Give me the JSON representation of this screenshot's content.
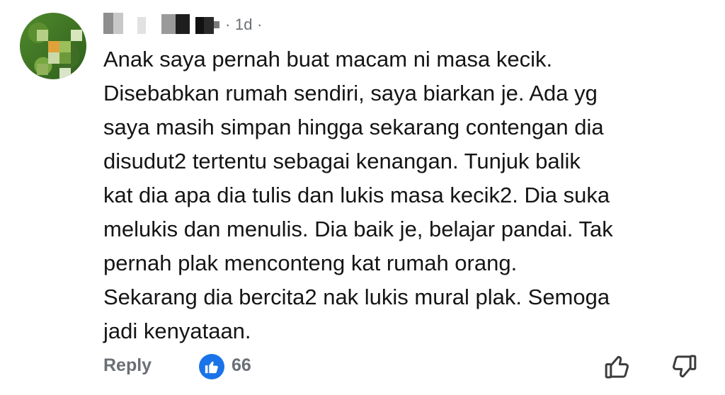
{
  "comment": {
    "author_blurred": true,
    "meta": "· 1d ·",
    "text": "Anak saya pernah buat macam ni masa kecik.\nDisebabkan rumah sendiri, saya biarkan je. Ada yg\nsaya masih simpan hingga sekarang contengan dia\ndisudut2 tertentu sebagai kenangan. Tunjuk balik\nkat dia apa dia tulis dan lukis masa kecik2. Dia suka\nmelukis dan menulis. Dia baik je, belajar pandai. Tak\npernah plak menconteng kat rumah orang.\nSekarang dia bercita2 nak lukis mural plak. Semoga\njadi kenyataan."
  },
  "actions": {
    "reply_label": "Reply",
    "like_count": "66",
    "like_badge_color": "#1a73e8"
  },
  "icons": {
    "like_badge": "thumbs-up-icon",
    "upvote": "thumbs-up-outline-icon",
    "downvote": "thumbs-down-outline-icon"
  }
}
